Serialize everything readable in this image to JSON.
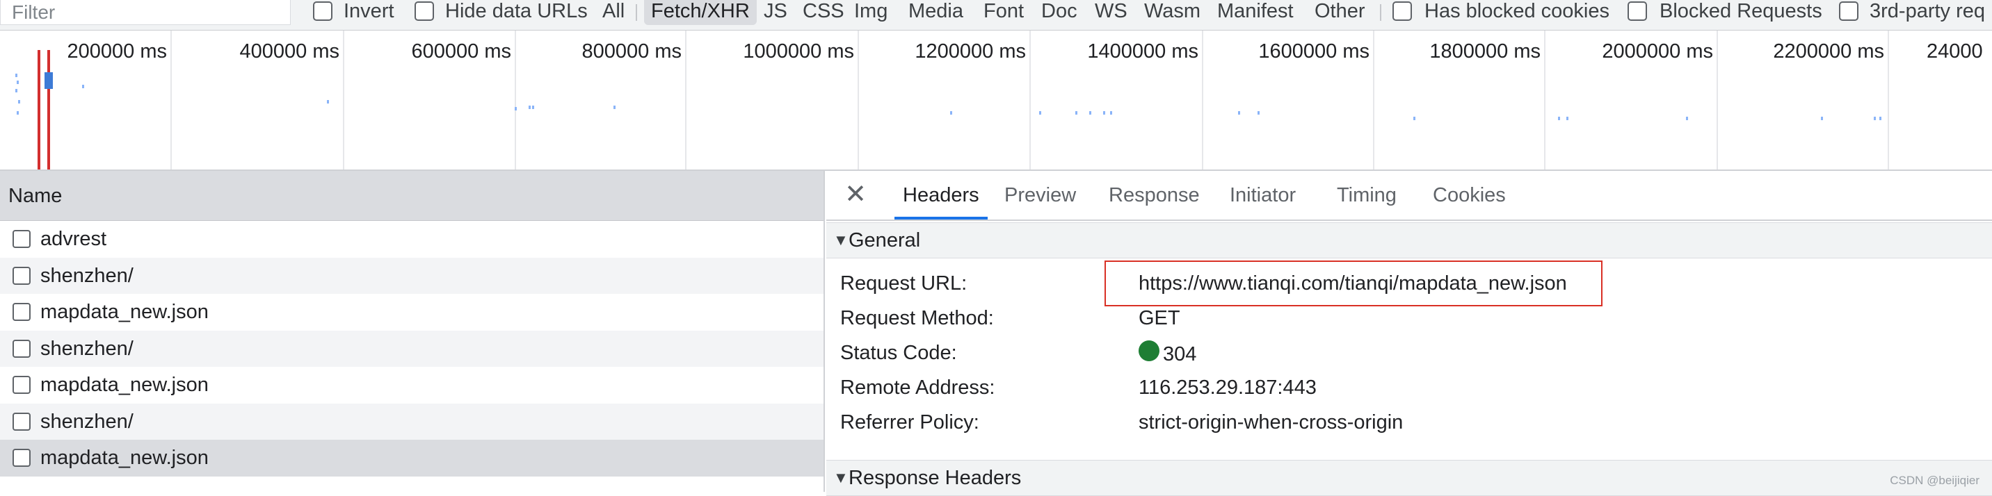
{
  "toolbar": {
    "filter_placeholder": "Filter",
    "invert": "Invert",
    "hide_data_urls": "Hide data URLs",
    "types": [
      "All",
      "Fetch/XHR",
      "JS",
      "CSS",
      "Img",
      "Media",
      "Font",
      "Doc",
      "WS",
      "Wasm",
      "Manifest",
      "Other"
    ],
    "active_type": "Fetch/XHR",
    "has_blocked_cookies": "Has blocked cookies",
    "blocked_requests": "Blocked Requests",
    "third_party": "3rd-party req"
  },
  "overview": {
    "ticks": [
      "200000 ms",
      "400000 ms",
      "600000 ms",
      "800000 ms",
      "1000000 ms",
      "1200000 ms",
      "1400000 ms",
      "1600000 ms",
      "1800000 ms",
      "2000000 ms",
      "2200000 ms",
      "24000"
    ]
  },
  "requests": {
    "column_name": "Name",
    "rows": [
      {
        "name": "advrest"
      },
      {
        "name": "shenzhen/"
      },
      {
        "name": "mapdata_new.json"
      },
      {
        "name": "shenzhen/"
      },
      {
        "name": "mapdata_new.json"
      },
      {
        "name": "shenzhen/"
      },
      {
        "name": "mapdata_new.json"
      }
    ],
    "selected_index": 6
  },
  "details": {
    "tabs": [
      "Headers",
      "Preview",
      "Response",
      "Initiator",
      "Timing",
      "Cookies"
    ],
    "active_tab": "Headers",
    "general": {
      "title": "General",
      "rows": [
        {
          "key": "Request URL:",
          "value": "https://www.tianqi.com/tianqi/mapdata_new.json"
        },
        {
          "key": "Request Method:",
          "value": "GET"
        },
        {
          "key": "Status Code:",
          "value": "304"
        },
        {
          "key": "Remote Address:",
          "value": "116.253.29.187:443"
        },
        {
          "key": "Referrer Policy:",
          "value": "strict-origin-when-cross-origin"
        }
      ],
      "status_color": "#1e7e34",
      "highlight_color": "#d93025"
    },
    "response_headers_title": "Response Headers"
  },
  "watermark": "CSDN @beijiqier"
}
